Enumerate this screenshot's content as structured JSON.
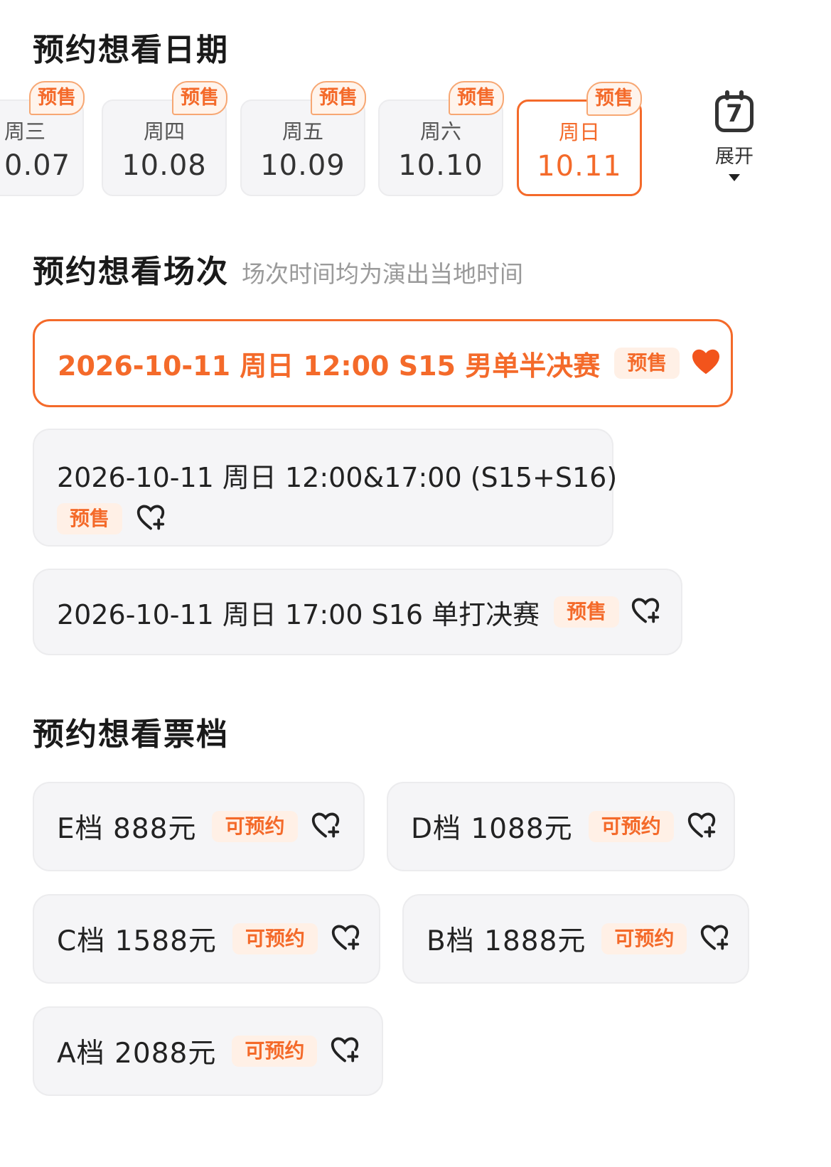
{
  "dates_section": {
    "title": "预约想看日期",
    "dates": [
      {
        "weekday": "周三",
        "date": "0.07",
        "tag": "预售"
      },
      {
        "weekday": "周四",
        "date": "10.08",
        "tag": "预售"
      },
      {
        "weekday": "周五",
        "date": "10.09",
        "tag": "预售"
      },
      {
        "weekday": "周六",
        "date": "10.10",
        "tag": "预售"
      },
      {
        "weekday": "周日",
        "date": "10.11",
        "tag": "预售"
      }
    ],
    "calendar_icon_number": "7",
    "expand_label": "展开"
  },
  "sessions_section": {
    "title": "预约想看场次",
    "note": "场次时间均为演出当地时间",
    "sessions": [
      {
        "text": "2026-10-11 周日 12:00  S15 男单半决赛",
        "tag": "预售",
        "favorited": true
      },
      {
        "text": "2026-10-11 周日 12:00&17:00 (S15+S16)",
        "tag": "预售",
        "favorited": false
      },
      {
        "text": "2026-10-11 周日 17:00 S16 单打决赛",
        "tag": "预售",
        "favorited": false
      }
    ]
  },
  "tiers_section": {
    "title": "预约想看票档",
    "tiers": [
      {
        "label": "E档 888元",
        "tag": "可预约"
      },
      {
        "label": "D档 1088元",
        "tag": "可预约"
      },
      {
        "label": "C档 1588元",
        "tag": "可预约"
      },
      {
        "label": "B档 1888元",
        "tag": "可预约"
      },
      {
        "label": "A档 2088元",
        "tag": "可预约"
      }
    ]
  },
  "colors": {
    "accent": "#f46a2a",
    "card_bg": "#f5f5f7",
    "chip_bg": "#fff0e6"
  }
}
